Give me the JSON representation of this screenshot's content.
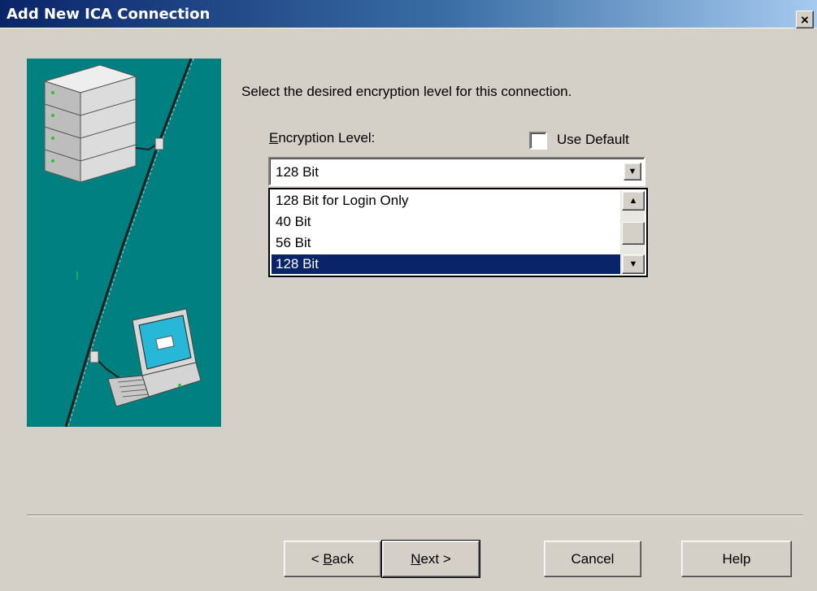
{
  "window": {
    "title": "Add New ICA Connection",
    "close_glyph": "×"
  },
  "main": {
    "prompt": "Select the desired encryption level for this connection.",
    "encryption_label_accel": "E",
    "encryption_label_rest": "ncryption Level:",
    "use_default_label": "Use Default",
    "use_default_checked": false,
    "selected_value": "128 Bit",
    "options": [
      "128 Bit for Login Only",
      "40 Bit",
      "56 Bit",
      "128 Bit"
    ],
    "highlighted_option": "128 Bit"
  },
  "buttons": {
    "back_prefix": "< ",
    "back_accel": "B",
    "back_rest": "ack",
    "next_accel": "N",
    "next_rest": "ext >",
    "cancel": "Cancel",
    "help": "Help"
  },
  "colors": {
    "dialog_bg": "#d4d0c8",
    "titlebar_start": "#0a246a",
    "titlebar_end": "#a6caf0",
    "art_bg": "#008080",
    "selection": "#0a246a"
  },
  "icons": [
    "close-icon",
    "server-rack-icon",
    "laptop-icon",
    "dropdown-arrow-icon",
    "scroll-up-icon",
    "scroll-down-icon"
  ]
}
